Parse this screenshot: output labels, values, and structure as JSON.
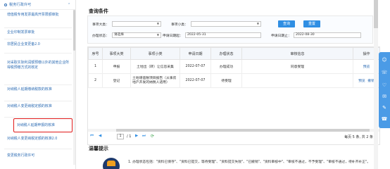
{
  "sidebar": {
    "header": "税务行政许可",
    "items": [
      {
        "label": "增值税专用发票最高开票限额审批",
        "line2": "额审批"
      },
      {
        "label": "企业印制发票审批"
      },
      {
        "label": "非居民企业变更备2.0"
      },
      {
        "label": "对采取实际利润额预缴以外的其他企业所得税预缴方式的核定"
      },
      {
        "label": "对纳税人延期缴纳税款的核准"
      },
      {
        "label": "对纳税人变更纳税定额的核准"
      },
      {
        "label": "对纳税人延期申报的核准"
      },
      {
        "label": "对纳税人变更纳税定额的核准2.0"
      },
      {
        "label": "变更税务行政许可"
      }
    ]
  },
  "query": {
    "section_title": "查询条件",
    "major_label": "事项大类：",
    "minor_label": "事项小类：",
    "status_label": "办理状态：",
    "status_value": "请选择",
    "date_start_label": "申请日期起：",
    "date_start_value": "2022-05-31",
    "date_end_label": "申请日期止：",
    "date_end_value": "2022-08-30",
    "search_btn": "查询",
    "reset_btn": "重置"
  },
  "table": {
    "headers": [
      "序号",
      "事项大类",
      "事项小类",
      "申请日期",
      "办理状态",
      "审核信息",
      "操作"
    ],
    "rows": [
      {
        "no": "1",
        "major": "申报",
        "minor": "土地出（转）让信息采集",
        "date": "2022-07-07",
        "status": "办理成功",
        "audit": "同意受理",
        "ops": [
          "预览"
        ]
      },
      {
        "no": "2",
        "major": "登记",
        "minor": "土地增值税项目报告（从事房地产开发的纳税人适用）",
        "date": "2022-07-07",
        "status": "待受理",
        "audit": "",
        "ops": [
          "预览",
          "撤销"
        ]
      }
    ]
  },
  "pager": {
    "current": "1",
    "total": "/ 1",
    "summary": "每页 5 条, 共 2 条"
  },
  "tips": {
    "title": "温馨提示",
    "text": "1. 办理状态包括：\"资料已保存\"、\"资料已提交，等待受理\"、\"资料提交失败\"、\"已撤销\"、\"资料审核中\"、\"审核不通过，不予受理\"、\"审核不通过，待补齐补正\"。"
  },
  "icons": {
    "page_first": "first-page-icon",
    "page_prev": "prev-page-icon",
    "page_next": "next-page-icon",
    "page_last": "last-page-icon",
    "refresh": "refresh-icon",
    "toolbar": [
      "chat-icon",
      "service-icon",
      "favorite-icon",
      "feedback-icon",
      "edit-icon",
      "phone-icon"
    ]
  },
  "colors": {
    "accent": "#2f8ee3",
    "link": "#2e6db4",
    "highlight_border": "#e01a1a",
    "toolbar": "#4b9be6"
  }
}
